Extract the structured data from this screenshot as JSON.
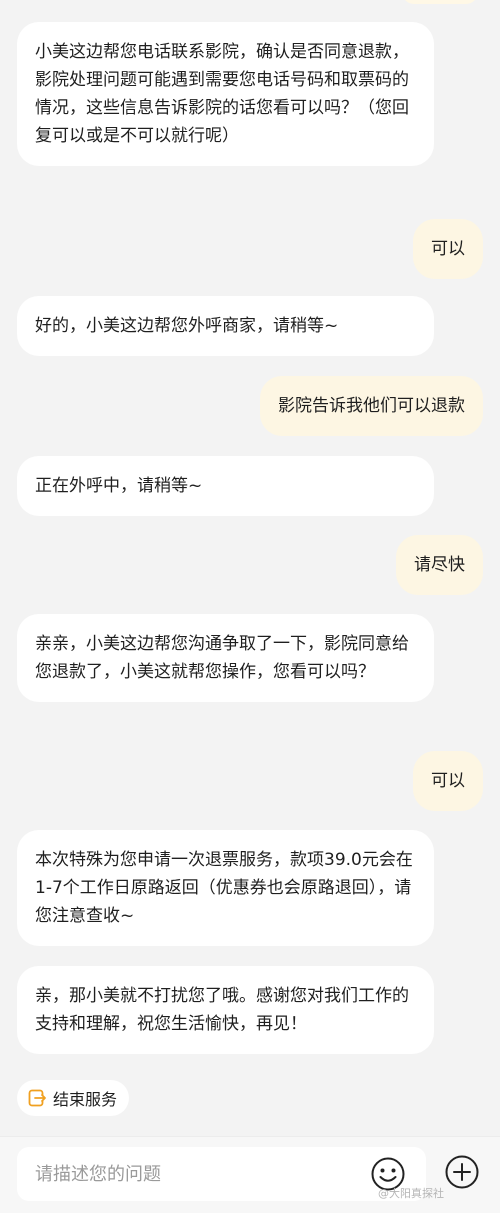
{
  "messages": [
    {
      "role": "bot",
      "text": "小美这边帮您电话联系影院，确认是否同意退款，影院处理问题可能遇到需要您电话号码和取票码的情况，这些信息告诉影院的话您看可以吗？（您回复可以或是不可以就行呢）"
    },
    {
      "role": "user",
      "text": "可以"
    },
    {
      "role": "bot",
      "text": "好的，小美这边帮您外呼商家，请稍等~"
    },
    {
      "role": "user",
      "text": "影院告诉我他们可以退款"
    },
    {
      "role": "bot",
      "text": "正在外呼中，请稍等~"
    },
    {
      "role": "user",
      "text": "请尽快"
    },
    {
      "role": "bot",
      "text": "亲亲，小美这边帮您沟通争取了一下，影院同意给您退款了，小美这就帮您操作，您看可以吗？"
    },
    {
      "role": "user",
      "text": "可以"
    },
    {
      "role": "bot",
      "text": "本次特殊为您申请一次退票服务，款项39.0元会在1-7个工作日原路返回（优惠券也会原路退回），请您注意查收~"
    },
    {
      "role": "bot",
      "text": "亲，那小美就不打扰您了哦。感谢您对我们工作的支持和理解，祝您生活愉快，再见！"
    }
  ],
  "end_service": {
    "label": "结束服务",
    "icon": "exit-icon",
    "accent": "#f0a020"
  },
  "input": {
    "placeholder": "请描述您的问题"
  },
  "watermark": "@大阳真探社",
  "icons": {
    "emoji": "smiley-icon",
    "plus": "plus-circle-icon"
  }
}
